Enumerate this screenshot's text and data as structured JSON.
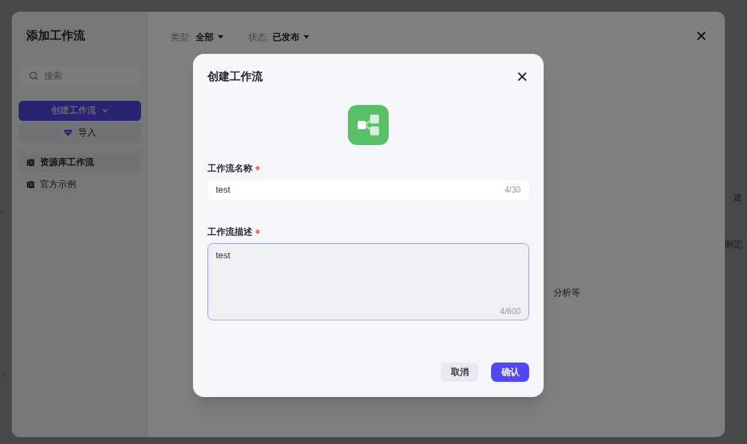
{
  "background_fragments": [
    {
      "text": "。"
    },
    {
      "text": "。"
    },
    {
      "text": "途"
    },
    {
      "text": "制定"
    },
    {
      "text": "分析等"
    }
  ],
  "drawer": {
    "title": "添加工作流",
    "search": {
      "placeholder": "搜索"
    },
    "create_button": {
      "label": "创建工作流"
    },
    "import_button": {
      "label": "导入"
    },
    "nav": [
      {
        "label": "资源库工作流",
        "selected": true
      },
      {
        "label": "官方示例",
        "selected": false
      }
    ],
    "filters": [
      {
        "label": "类型:",
        "value": "全部"
      },
      {
        "label": "状态:",
        "value": "已发布"
      }
    ]
  },
  "dialog": {
    "title": "创建工作流",
    "fields": [
      {
        "kind": "input",
        "label": "工作流名称",
        "required": true,
        "focused": false,
        "value": "test",
        "counter": "4/30"
      },
      {
        "kind": "textarea",
        "label": "工作流描述",
        "required": true,
        "focused": true,
        "value": "test",
        "counter": "4/600"
      }
    ],
    "buttons": [
      {
        "label": "取消",
        "kind": "secondary"
      },
      {
        "label": "确认",
        "kind": "primary"
      }
    ]
  }
}
